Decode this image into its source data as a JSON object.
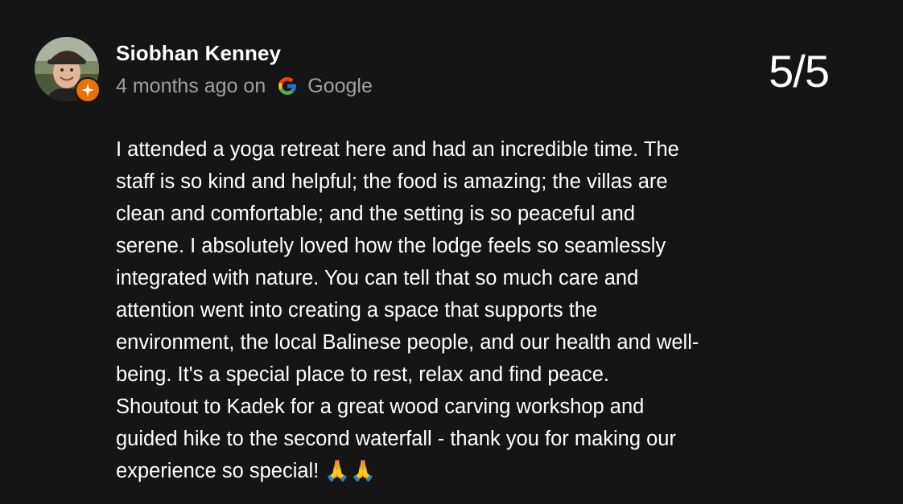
{
  "review": {
    "reviewer_name": "Siobhan Kenney",
    "time_ago": "4 months ago on",
    "source": "Google",
    "rating": "5/5",
    "text": "I attended a yoga retreat here and had an incredible time. The\nstaff is so kind and helpful; the food is amazing; the villas are\nclean and comfortable; and the setting is so peaceful and\nserene. I absolutely loved how the lodge feels so seamlessly\nintegrated with nature. You can tell that so much care and\nattention went into creating a space that supports the\nenvironment, the local Balinese people, and our health and well-\nbeing. It's a special place to rest, relax and find peace.\nShoutout to Kadek for a great wood carving workshop and\nguided hike to the second waterfall - thank you for making our\nexperience so special! 🙏🙏"
  },
  "icons": {
    "avatar": "reviewer-avatar",
    "badge": "local-guide-badge-icon",
    "source_logo": "google-logo-icon"
  },
  "colors": {
    "background": "#151515",
    "text_primary": "#ffffff",
    "text_secondary": "#a0a0a0",
    "badge_orange": "#e8710a"
  }
}
